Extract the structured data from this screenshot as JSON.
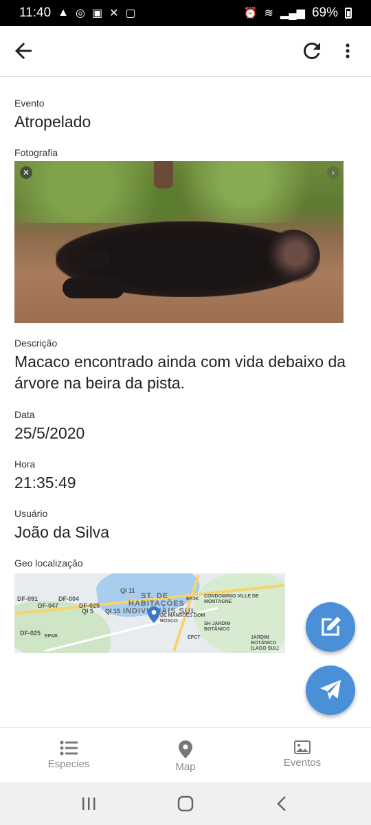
{
  "status_bar": {
    "time": "11:40",
    "battery_percent": "69%",
    "icons_left": [
      "alert-icon",
      "instagram-icon",
      "voicemail-icon",
      "missed-call-icon",
      "photo-icon"
    ],
    "icons_right": [
      "alarm-icon",
      "wifi-icon",
      "signal-icon",
      "battery-icon"
    ]
  },
  "app_bar": {
    "icons": [
      "back-arrow-icon",
      "refresh-icon",
      "more-vert-icon"
    ]
  },
  "details": {
    "evento_label": "Evento",
    "evento_value": "Atropelado",
    "fotografia_label": "Fotografia",
    "descricao_label": "Descrição",
    "descricao_value": "Macaco encontrado ainda com vida debaixo da árvore na beira da pista.",
    "data_label": "Data",
    "data_value": "25/5/2020",
    "hora_label": "Hora",
    "hora_value": "21:35:49",
    "usuario_label": "Usuário",
    "usuario_value": "João da Silva",
    "geo_label": "Geo localização"
  },
  "map": {
    "labels": {
      "df091": "DF-091",
      "df047": "DF-047",
      "df004": "DF-004",
      "df025a": "DF-025",
      "df025b": "DF-025",
      "qi11": "QI 11",
      "qi15": "QI 15",
      "qi5": "QI 5",
      "st_de_line1": "ST. DE",
      "st_de_line2": "HABITAÇÕES",
      "st_de_line3": "INDIVIDUAIS SUL",
      "condominio": "CONDOMINIO VILLE DE MONTAGNE",
      "mansoes": "DE MANSÕES DOM BOSCO",
      "sh_jardim": "SH JARDIM BOTÂNICO",
      "jardim_lago": "JARDIM BOTÂNICO (LAGO SUL)",
      "epjk": "EPJK",
      "epct": "EPCT",
      "epab": "EPAB"
    },
    "colors": {
      "water": "#a9cdee",
      "park": "#cfe6c6",
      "road": "#f6d46b",
      "pin": "#3a78c2"
    }
  },
  "fabs": {
    "edit_icon": "edit-icon",
    "send_icon": "send-icon",
    "color": "#4a90d9"
  },
  "bottom_nav": {
    "items": [
      {
        "label": "Especies",
        "icon": "list-icon"
      },
      {
        "label": "Map",
        "icon": "location-pin-icon"
      },
      {
        "label": "Eventos",
        "icon": "image-icon"
      }
    ]
  },
  "system_nav": [
    "recents-icon",
    "home-icon",
    "back-icon"
  ]
}
